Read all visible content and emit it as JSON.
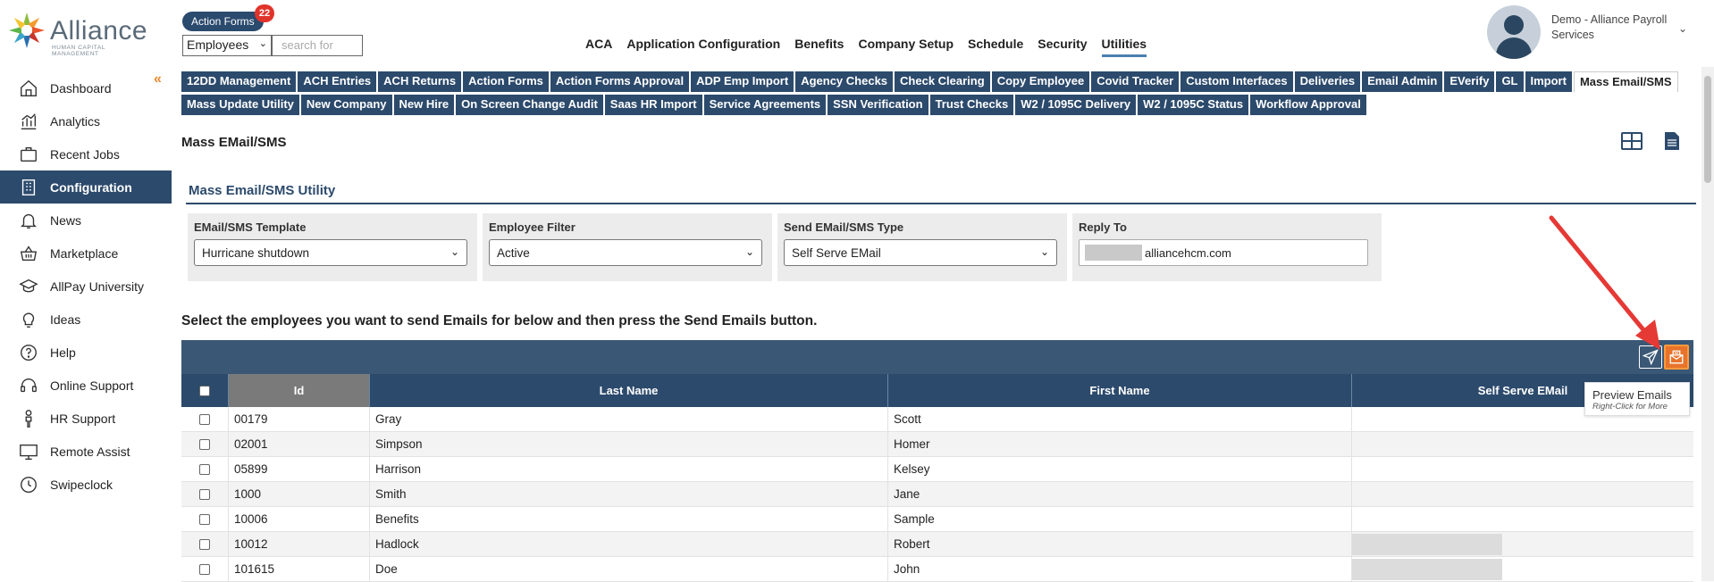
{
  "header": {
    "logo_text": "Alliance",
    "logo_subtitle": "HUMAN CAPITAL MANAGEMENT",
    "action_forms_label": "Action Forms",
    "action_forms_count": "22",
    "employee_select_value": "Employees",
    "search_placeholder": "search for",
    "nav": [
      "ACA",
      "Application Configuration",
      "Benefits",
      "Company Setup",
      "Schedule",
      "Security",
      "Utilities"
    ],
    "active_nav": "Utilities",
    "user_name": "Demo - Alliance Payroll Services"
  },
  "sidebar": {
    "items": [
      {
        "label": "Dashboard",
        "icon": "home-icon"
      },
      {
        "label": "Analytics",
        "icon": "analytics-icon"
      },
      {
        "label": "Recent Jobs",
        "icon": "briefcase-icon"
      },
      {
        "label": "Configuration",
        "icon": "building-icon"
      },
      {
        "label": "News",
        "icon": "bell-icon"
      },
      {
        "label": "Marketplace",
        "icon": "basket-icon"
      },
      {
        "label": "AllPay University",
        "icon": "graduation-icon"
      },
      {
        "label": "Ideas",
        "icon": "lightbulb-icon"
      },
      {
        "label": "Help",
        "icon": "question-icon"
      },
      {
        "label": "Online Support",
        "icon": "headset-icon"
      },
      {
        "label": "HR Support",
        "icon": "person-icon"
      },
      {
        "label": "Remote Assist",
        "icon": "monitor-icon"
      },
      {
        "label": "Swipeclock",
        "icon": "clock-icon"
      }
    ],
    "active": "Configuration"
  },
  "tabs": {
    "row1": [
      "12DD Management",
      "ACH Entries",
      "ACH Returns",
      "Action Forms",
      "Action Forms Approval",
      "ADP Emp Import",
      "Agency Checks",
      "Check Clearing",
      "Copy Employee",
      "Covid Tracker",
      "Custom Interfaces",
      "Deliveries",
      "Email Admin",
      "EVerify",
      "GL",
      "Import",
      "Mass Email/SMS"
    ],
    "row2": [
      "Mass Update Utility",
      "New Company",
      "New Hire",
      "On Screen Change Audit",
      "Saas HR Import",
      "Service Agreements",
      "SSN Verification",
      "Trust Checks",
      "W2 / 1095C Delivery",
      "W2 / 1095C Status",
      "Workflow Approval"
    ],
    "active": "Mass Email/SMS"
  },
  "page": {
    "title": "Mass EMail/SMS",
    "utility_title": "Mass Email/SMS Utility",
    "fields": {
      "template_label": "EMail/SMS Template",
      "template_value": "Hurricane shutdown",
      "filter_label": "Employee Filter",
      "filter_value": "Active",
      "type_label": "Send EMail/SMS Type",
      "type_value": "Self Serve EMail",
      "reply_label": "Reply To",
      "reply_value": "alliancehcm.com"
    },
    "instructions": "Select the employees you want to send Emails for below and then press the Send Emails button."
  },
  "table": {
    "columns": [
      "Id",
      "Last Name",
      "First Name",
      "Self Serve EMail"
    ],
    "rows": [
      {
        "id": "00179",
        "last": "Gray",
        "first": "Scott",
        "email": ""
      },
      {
        "id": "02001",
        "last": "Simpson",
        "first": "Homer",
        "email": ""
      },
      {
        "id": "05899",
        "last": "Harrison",
        "first": "Kelsey",
        "email": ""
      },
      {
        "id": "1000",
        "last": "Smith",
        "first": "Jane",
        "email": ""
      },
      {
        "id": "10006",
        "last": "Benefits",
        "first": "Sample",
        "email": ""
      },
      {
        "id": "10012",
        "last": "Hadlock",
        "first": "Robert",
        "email": ""
      },
      {
        "id": "101615",
        "last": "Doe",
        "first": "John",
        "email": ""
      }
    ]
  },
  "tooltip": {
    "title": "Preview Emails",
    "subtitle": "Right-Click for More"
  },
  "colors": {
    "navy": "#2c4a6c",
    "toolbar": "#3a5876",
    "accent_orange": "#e8732a",
    "arrow_red": "#e53935"
  }
}
